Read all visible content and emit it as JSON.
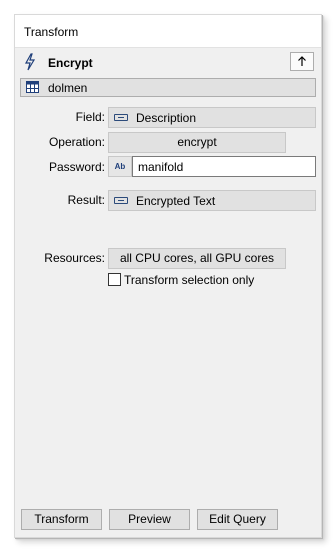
{
  "window": {
    "title": "Transform"
  },
  "transform": {
    "name": "Encrypt"
  },
  "source": {
    "name": "dolmen"
  },
  "form": {
    "field": {
      "label": "Field:",
      "value": "Description"
    },
    "operation": {
      "label": "Operation:",
      "value": "encrypt"
    },
    "password": {
      "label": "Password:",
      "value": "manifold",
      "type_badge": "Ab"
    },
    "result": {
      "label": "Result:",
      "value": "Encrypted Text"
    },
    "resources": {
      "label": "Resources:",
      "value": "all CPU cores, all GPU cores"
    },
    "selection_only": {
      "label": "Transform selection only",
      "checked": false
    }
  },
  "buttons": {
    "transform": "Transform",
    "preview": "Preview",
    "edit_query": "Edit Query"
  },
  "icons": {
    "transform_icon": "lightning-bolt-icon",
    "up": "arrow-up-icon",
    "table": "table-icon",
    "field": "field-icon",
    "text_type": "text-type-icon"
  },
  "colors": {
    "panel_bg": "#f0f0f0",
    "button_bg": "#e1e1e1",
    "icon_blue": "#1f3f7a"
  }
}
